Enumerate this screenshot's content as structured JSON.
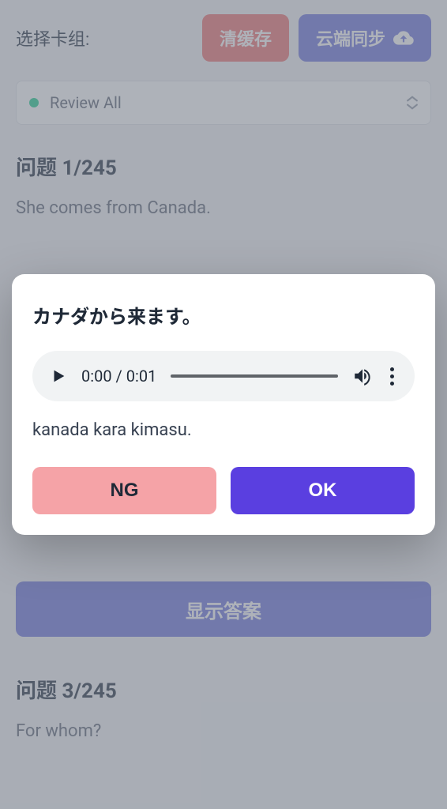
{
  "topbar": {
    "select_label": "选择卡组:",
    "clear_label": "清缓存",
    "sync_label": "云端同步"
  },
  "deck": {
    "status_color": "#34d399",
    "name": "Review All"
  },
  "cards": [
    {
      "title": "问题 1/245",
      "text": "She comes from Canada."
    },
    {
      "title": "问题 3/245",
      "text": "For whom?"
    }
  ],
  "show_answer_label": "显示答案",
  "modal": {
    "title": "カナダから来ます。",
    "audio": {
      "time": "0:00 / 0:01"
    },
    "romaji": "kanada kara kimasu.",
    "ng_label": "NG",
    "ok_label": "OK"
  }
}
